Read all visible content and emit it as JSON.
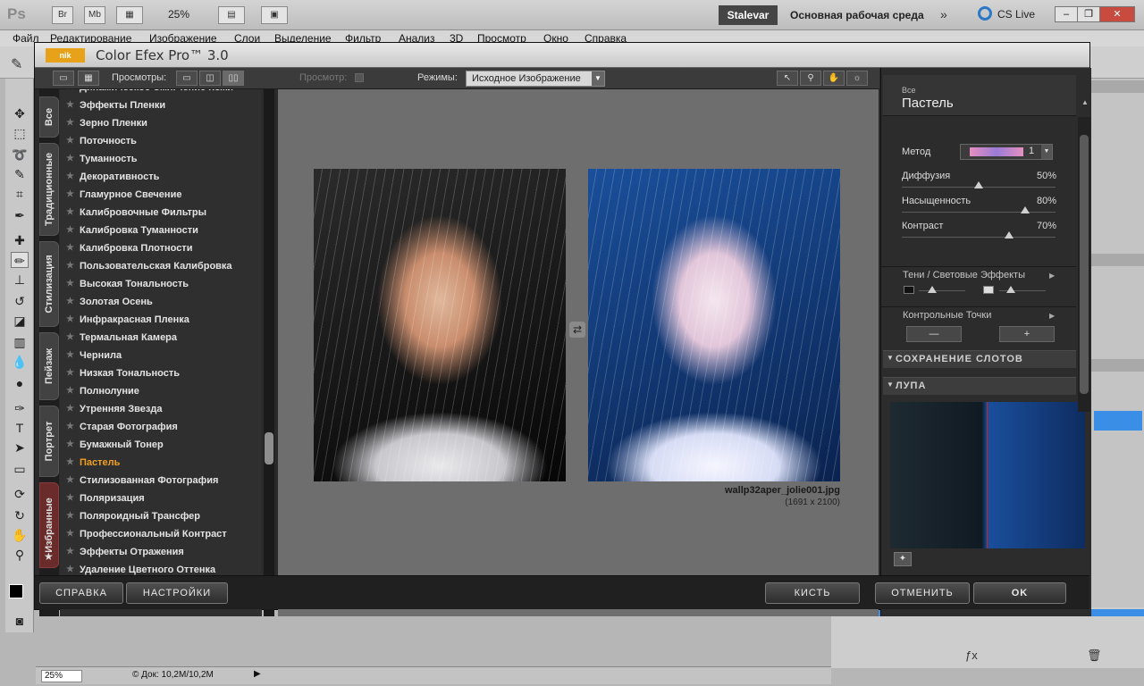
{
  "app": {
    "logo": "Ps",
    "appbar_buttons": [
      "Br",
      "Mb"
    ],
    "zoom": "25%",
    "workspace_user": "Stalevar",
    "workspace_name": "Основная рабочая среда",
    "cs_live": "CS Live"
  },
  "menu": [
    "Файл",
    "Редактирование",
    "Изображение",
    "Слои",
    "Выделение",
    "Фильтр",
    "Анализ",
    "3D",
    "Просмотр",
    "Окно",
    "Справка"
  ],
  "status": {
    "zoom": "25%",
    "doc": "© Док: 10,2М/10,2М"
  },
  "plugin": {
    "title": "Color Efex Pro™ 3.0",
    "logo": "nik",
    "toolbar": {
      "views_label": "Просмотры:",
      "preview_label": "Просмотр:",
      "modes_label": "Режимы:",
      "mode_value": "Исходное Изображение"
    },
    "tabs": [
      "Все",
      "Традиционные",
      "Стилизация",
      "Пейзаж",
      "Портрет",
      "Избранные"
    ],
    "filters": [
      "Динамическое Смягчение Кожи",
      "Эффекты Пленки",
      "Зерно Пленки",
      "Поточность",
      "Туманность",
      "Декоративность",
      "Гламурное Свечение",
      "Калибровочные Фильтры",
      "Калибровка Туманности",
      "Калибровка Плотности",
      "Пользовательская Калибровка",
      "Высокая Тональность",
      "Золотая Осень",
      "Инфракрасная Пленка",
      "Термальная Камера",
      "Чернила",
      "Низкая Тональность",
      "Полнолуние",
      "Утренняя Звезда",
      "Старая Фотография",
      "Бумажный Тонер",
      "Пастель",
      "Стилизованная Фотография",
      "Поляризация",
      "Поляроидный Трансфер",
      "Профессиональный Контраст",
      "Эффекты Отражения",
      "Удаление Цветного Оттенка"
    ],
    "selected_filter": "Пастель",
    "preview": {
      "file_name": "wallp32aper_jolie001.jpg",
      "file_size": "(1691 x 2100)"
    },
    "controls": {
      "category": "Все",
      "filter_name": "Пастель",
      "method_label": "Метод",
      "method_value": "1",
      "sliders": [
        {
          "label": "Диффузия",
          "value": "50%",
          "fraction": 0.5
        },
        {
          "label": "Насыщенность",
          "value": "80%",
          "fraction": 0.8
        },
        {
          "label": "Контраст",
          "value": "70%",
          "fraction": 0.7
        }
      ],
      "shadows_label": "Тени / Световые Эффекты",
      "control_points_label": "Контрольные Точки",
      "cp_minus": "—",
      "cp_plus": "+",
      "save_slots": "СОХРАНЕНИЕ СЛОТОВ",
      "loupe": "ЛУПА"
    },
    "buttons": {
      "help": "СПРАВКА",
      "settings": "НАСТРОЙКИ",
      "brush": "КИСТЬ",
      "cancel": "ОТМЕНИТЬ",
      "ok": "OK"
    }
  }
}
